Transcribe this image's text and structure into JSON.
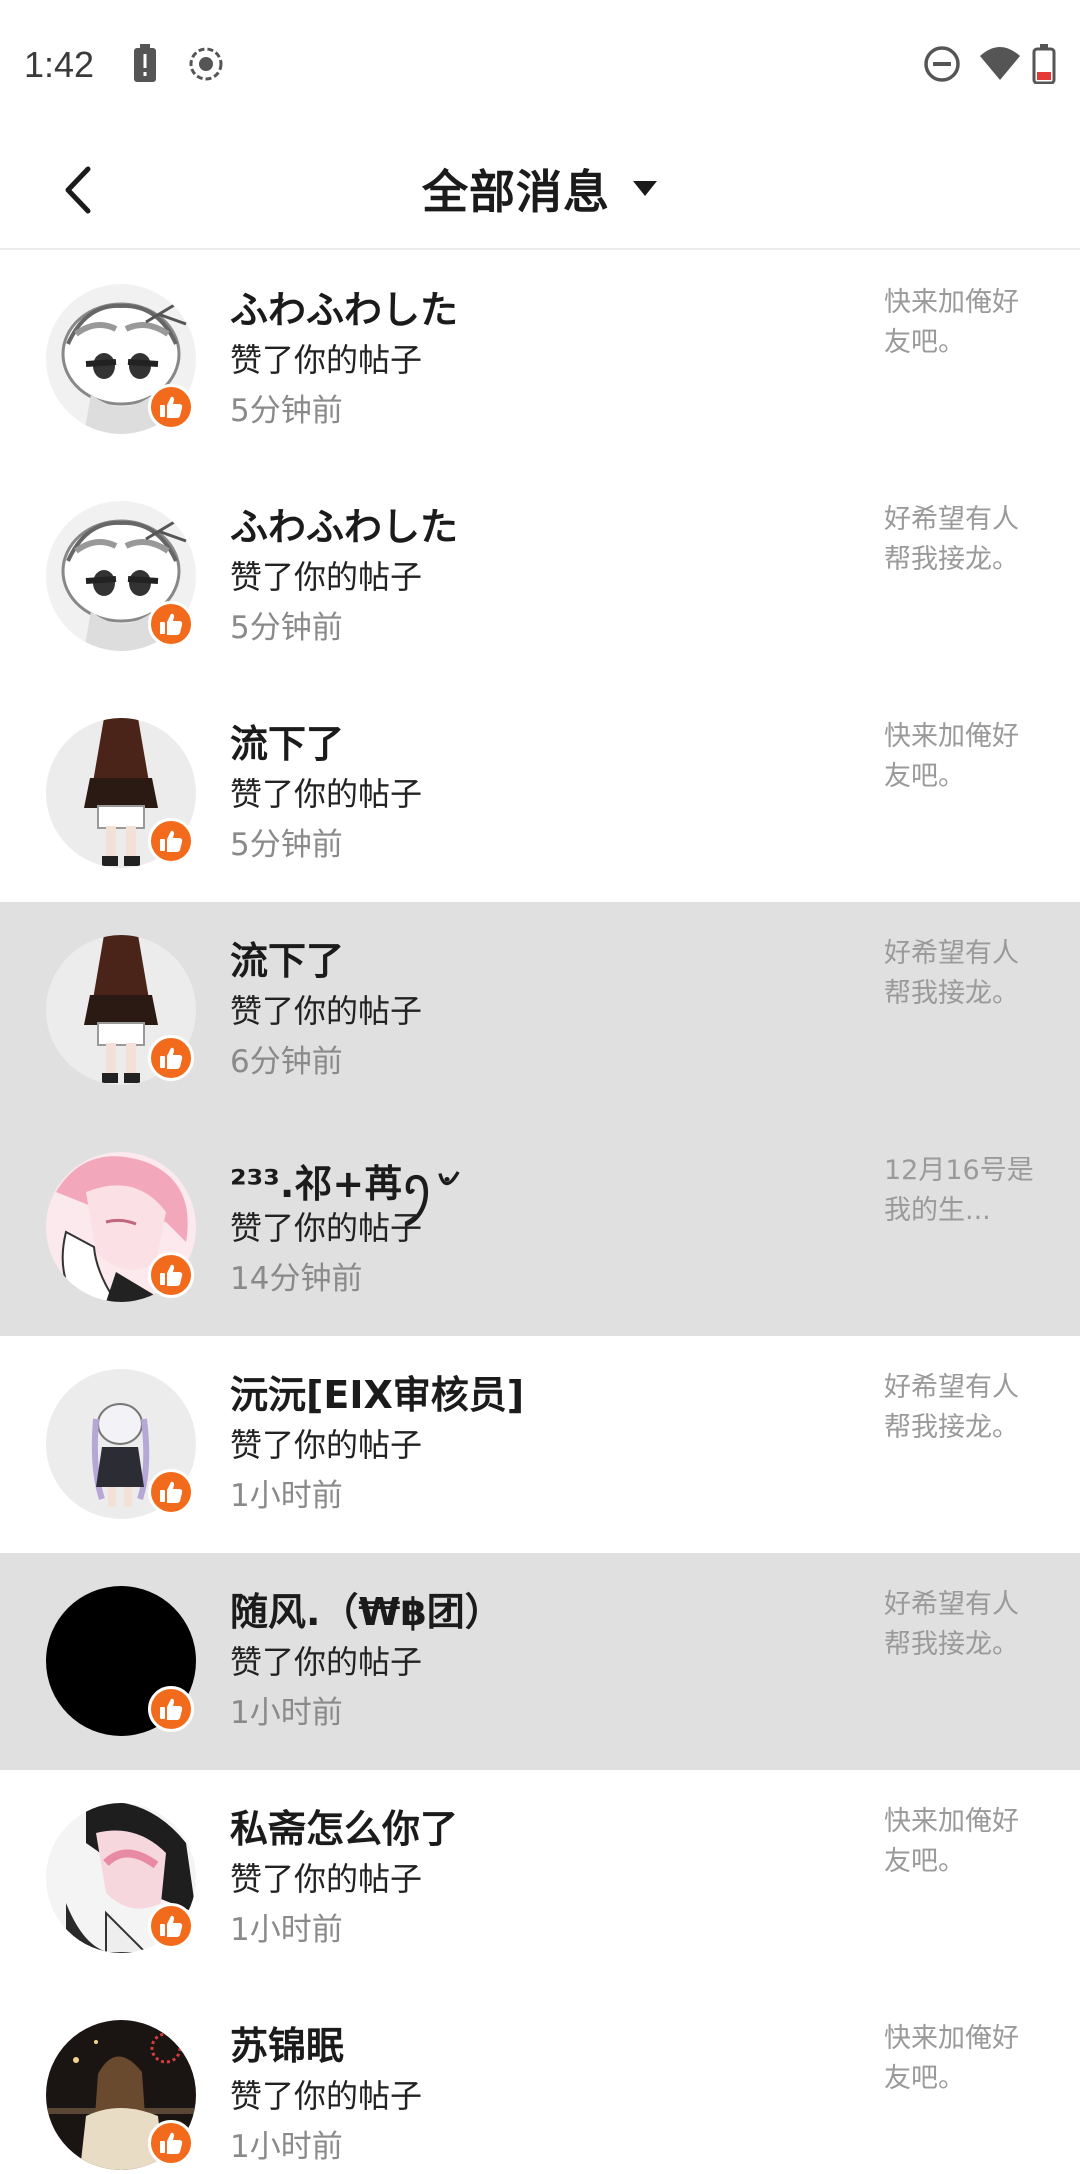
{
  "status_bar": {
    "time": "1:42",
    "left_icons": [
      "battery-alert-icon",
      "screen-record-icon"
    ],
    "right_icons": [
      "do-not-disturb-icon",
      "wifi-icon",
      "battery-low-icon"
    ]
  },
  "header": {
    "back_icon": "chevron-left-icon",
    "title": "全部消息",
    "dropdown_icon": "caret-down-icon"
  },
  "colors": {
    "accent": "#f26a1b",
    "selected_row_bg": "#e0e0e0",
    "muted_text": "#8a8a8a"
  },
  "notifications": [
    {
      "name": "ふわふわした",
      "action": "赞了你的帖子",
      "time": "5分钟前",
      "post": "快来加俺好友吧。",
      "avatar": "sketch-girl",
      "selected": false
    },
    {
      "name": "ふわふわした",
      "action": "赞了你的帖子",
      "time": "5分钟前",
      "post": "好希望有人帮我接龙。",
      "avatar": "sketch-girl",
      "selected": false
    },
    {
      "name": "流下了",
      "action": "赞了你的帖子",
      "time": "5分钟前",
      "post": "快来加俺好友吧。",
      "avatar": "standing-figure",
      "selected": false
    },
    {
      "name": "流下了",
      "action": "赞了你的帖子",
      "time": "6分钟前",
      "post": "好希望有人帮我接龙。",
      "avatar": "standing-figure",
      "selected": true
    },
    {
      "name": "²³³.祁+苒ꪆ৺",
      "action": "赞了你的帖子",
      "time": "14分钟前",
      "post": "12月16号是我的生...",
      "avatar": "pink-hair",
      "selected": true
    },
    {
      "name": "沅沅[EIX审核员]",
      "action": "赞了你的帖子",
      "time": "1小时前",
      "post": "好希望有人帮我接龙。",
      "avatar": "chibi-white-hair",
      "selected": false
    },
    {
      "name": "随风.（₩฿团）",
      "action": "赞了你的帖子",
      "time": "1小时前",
      "post": "好希望有人帮我接龙。",
      "avatar": "black-circle",
      "selected": true
    },
    {
      "name": "私斋怎么你了",
      "action": "赞了你的帖子",
      "time": "1小时前",
      "post": "快来加俺好友吧。",
      "avatar": "pink-hair-dark",
      "selected": false
    },
    {
      "name": "苏锦眠",
      "action": "赞了你的帖子",
      "time": "1小时前",
      "post": "快来加俺好友吧。",
      "avatar": "night-photo",
      "selected": false
    }
  ]
}
